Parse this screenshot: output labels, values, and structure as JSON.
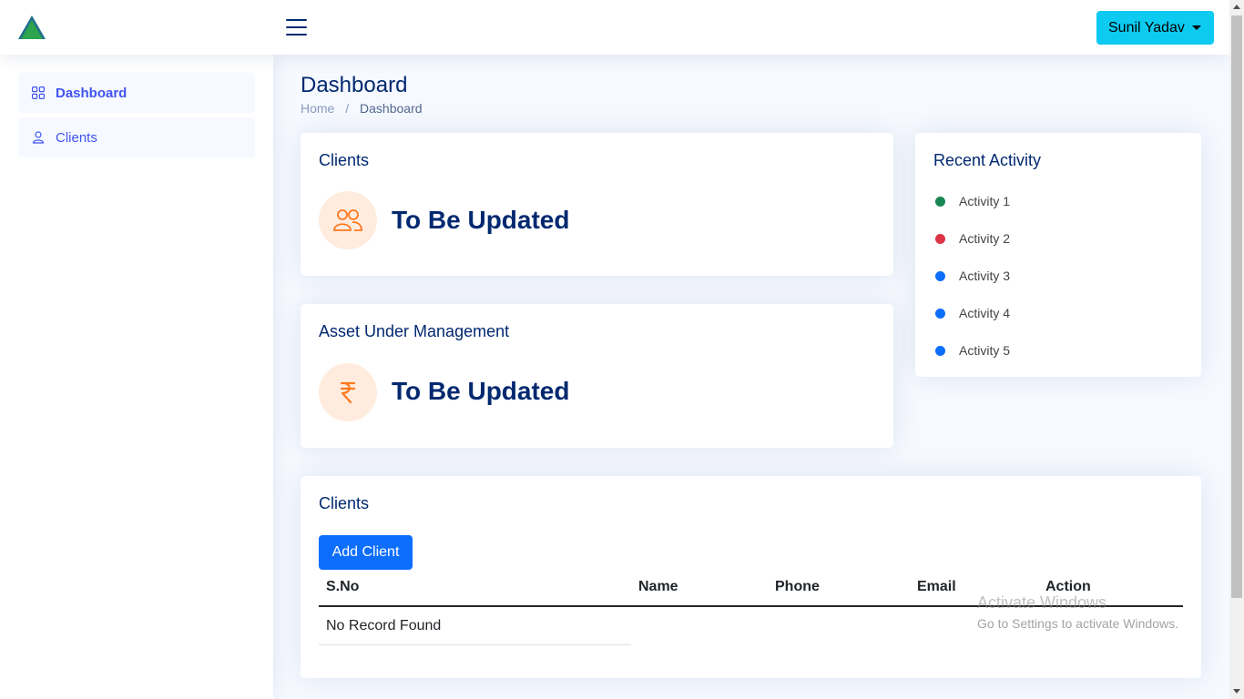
{
  "header": {
    "user_name": "Sunil Yadav"
  },
  "sidebar": {
    "items": [
      {
        "label": "Dashboard",
        "icon": "grid-icon"
      },
      {
        "label": "Clients",
        "icon": "person-icon"
      }
    ]
  },
  "page": {
    "title": "Dashboard",
    "breadcrumb": [
      "Home",
      "Dashboard"
    ]
  },
  "cards": {
    "clients": {
      "title": "Clients",
      "value": "To Be Updated",
      "icon": "people-icon"
    },
    "aum": {
      "title": "Asset Under Management",
      "value": "To Be Updated",
      "icon": "rupee-icon"
    }
  },
  "recent_activity": {
    "title": "Recent Activity",
    "items": [
      {
        "label": "Activity 1",
        "color": "#198754"
      },
      {
        "label": "Activity 2",
        "color": "#dc3545"
      },
      {
        "label": "Activity 3",
        "color": "#0d6efd"
      },
      {
        "label": "Activity 4",
        "color": "#0d6efd"
      },
      {
        "label": "Activity 5",
        "color": "#0d6efd"
      }
    ]
  },
  "clients_table": {
    "title": "Clients",
    "add_button": "Add Client",
    "columns": [
      "S.No",
      "Name",
      "Phone",
      "Email",
      "Action"
    ],
    "empty_message": "No Record Found"
  },
  "watermark": {
    "line1": "Activate Windows",
    "line2": "Go to Settings to activate Windows."
  },
  "colors": {
    "accent": "#4154f1",
    "navy": "#012970",
    "user_button": "#0dcaf0",
    "primary_button": "#0d6efd",
    "icon_bg": "#ffecdf",
    "icon_fg": "#ff771d"
  }
}
